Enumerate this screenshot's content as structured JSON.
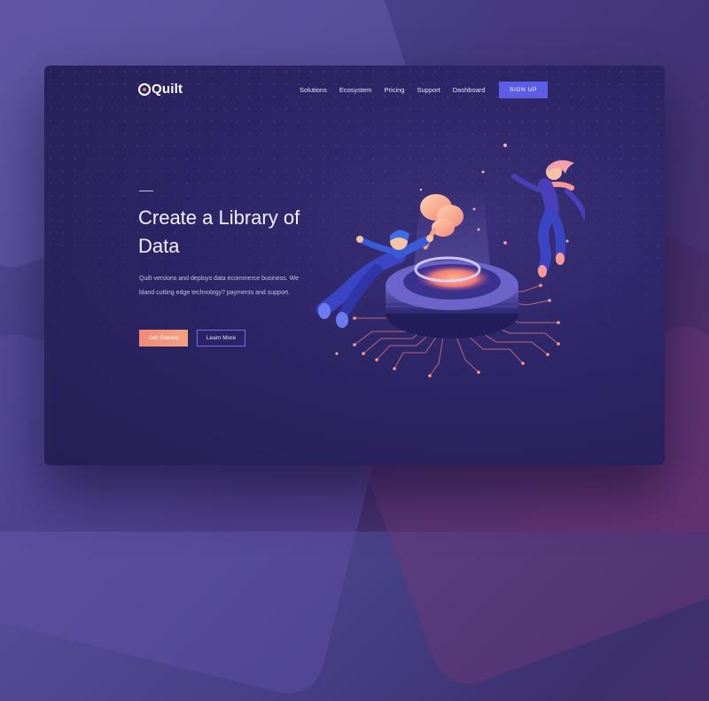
{
  "brand": {
    "name": "Quilt"
  },
  "nav": {
    "items": [
      "Solutions",
      "Ecosystem",
      "Pricing",
      "Support",
      "Dashboard"
    ],
    "signup_label": "SIGN UP"
  },
  "hero": {
    "headline": "Create a Library of Data",
    "description": "Quilt versions and deploys data ecommerce business. We bland cutting edge technology? payments and support.",
    "primary_cta": "Get Started",
    "secondary_cta": "Learn More"
  },
  "colors": {
    "accent": "#5c5ee6",
    "cta": "#f28b76",
    "card_bg": "#2c2566",
    "glow": "#f58a7a"
  }
}
